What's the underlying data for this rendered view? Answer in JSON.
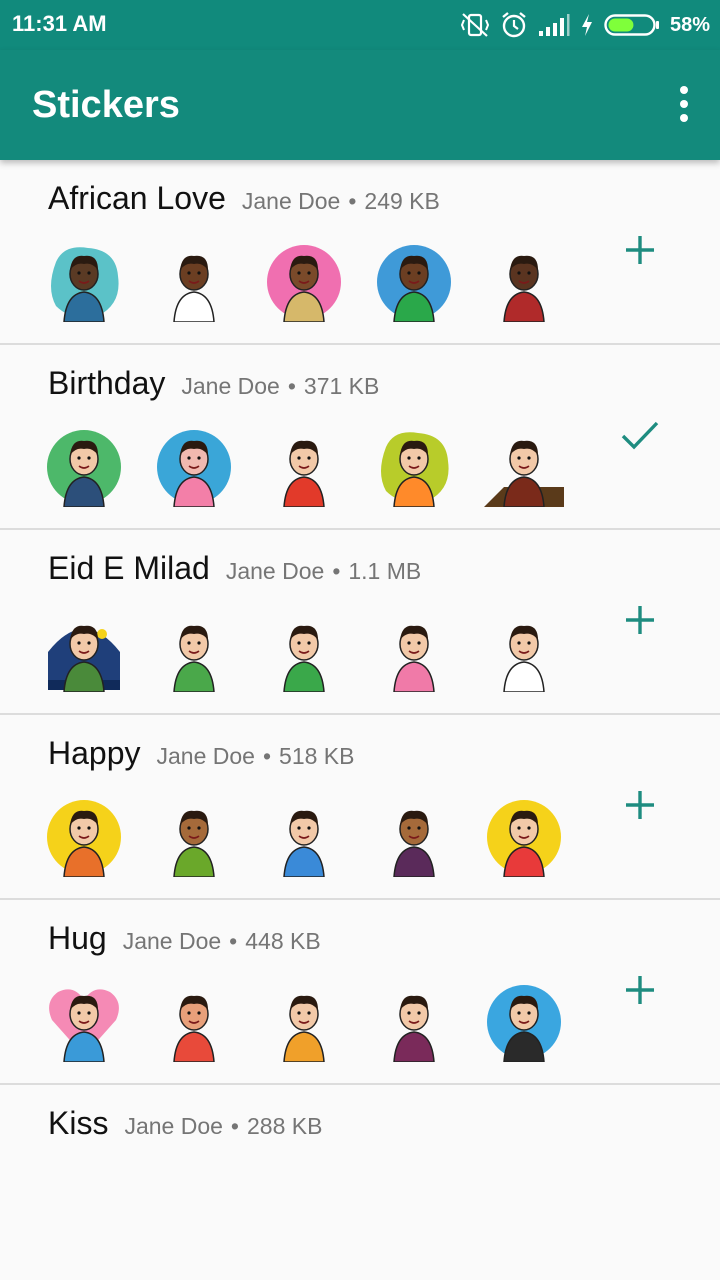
{
  "status_bar": {
    "time": "11:31 AM",
    "battery_percent": "58%",
    "battery_level": 0.58,
    "icons": [
      "vibrate-off-icon",
      "alarm-icon",
      "signal-icon",
      "charging-icon",
      "battery-icon"
    ]
  },
  "app_bar": {
    "title": "Stickers",
    "menu_icon": "overflow-menu-icon"
  },
  "colors": {
    "primary": "#138a7c",
    "accent": "#1e8c80"
  },
  "packs": [
    {
      "name": "African Love",
      "author": "Jane Doe",
      "size": "249 KB",
      "action": "add-icon",
      "stickers": [
        {
          "bg": "#5bc2c8",
          "shape": "blob",
          "skin": "#5a3a24",
          "shirt": "#2c6e9c"
        },
        {
          "bg": "#ffffff",
          "shape": "none",
          "skin": "#6b3e22",
          "shirt": "#ffffff"
        },
        {
          "bg": "#f06fb0",
          "shape": "circle",
          "skin": "#7a4a2a",
          "shirt": "#d6b86a"
        },
        {
          "bg": "#3f9ad8",
          "shape": "circle",
          "skin": "#6b3e22",
          "shirt": "#2aa84a"
        },
        {
          "bg": "#ffffff",
          "shape": "none",
          "skin": "#5a3420",
          "shirt": "#b02a2a"
        }
      ]
    },
    {
      "name": "Birthday",
      "author": "Jane Doe",
      "size": "371 KB",
      "action": "check-icon",
      "stickers": [
        {
          "bg": "#4db86a",
          "shape": "circle",
          "skin": "#f2c9a8",
          "shirt": "#2c4f7a"
        },
        {
          "bg": "#3aa6d8",
          "shape": "circle",
          "skin": "#f1b9b0",
          "shirt": "#f37fa8"
        },
        {
          "bg": "#ffffff",
          "shape": "none",
          "skin": "#f2c9a8",
          "shirt": "#e23a2a"
        },
        {
          "bg": "#b8cc2a",
          "shape": "blob",
          "skin": "#f2c9a8",
          "shirt": "#ff8a2a"
        },
        {
          "bg": "#5a3a1a",
          "shape": "table",
          "skin": "#f2c9a8",
          "shirt": "#7a2a1a"
        }
      ]
    },
    {
      "name": "Eid E Milad",
      "author": "Jane Doe",
      "size": "1.1 MB",
      "action": "add-icon",
      "stickers": [
        {
          "bg": "#1f3f7a",
          "shape": "dome",
          "skin": "#f2c9a8",
          "shirt": "#4a8a3a"
        },
        {
          "bg": "#ffffff",
          "shape": "none",
          "skin": "#f2c9a8",
          "shirt": "#4aa84a"
        },
        {
          "bg": "#ffffff",
          "shape": "none",
          "skin": "#f2c9a8",
          "shirt": "#3aa84a"
        },
        {
          "bg": "#ffffff",
          "shape": "none",
          "skin": "#f2c9a8",
          "shirt": "#f07aa8"
        },
        {
          "bg": "#ffffff",
          "shape": "none",
          "skin": "#f2c9a8",
          "shirt": "#ffffff"
        }
      ]
    },
    {
      "name": "Happy",
      "author": "Jane Doe",
      "size": "518 KB",
      "action": "add-icon",
      "stickers": [
        {
          "bg": "#f5d21a",
          "shape": "circle",
          "skin": "#f2c9a8",
          "shirt": "#e8702a"
        },
        {
          "bg": "#ffffff",
          "shape": "none",
          "skin": "#a56a3a",
          "shirt": "#6aa82a"
        },
        {
          "bg": "#ffffff",
          "shape": "none",
          "skin": "#f2c9a8",
          "shirt": "#3a8ad8"
        },
        {
          "bg": "#ffffff",
          "shape": "none",
          "skin": "#a56a3a",
          "shirt": "#5a2a5a"
        },
        {
          "bg": "#f5d21a",
          "shape": "circle",
          "skin": "#f2c9a8",
          "shirt": "#e83a3a"
        }
      ]
    },
    {
      "name": "Hug",
      "author": "Jane Doe",
      "size": "448 KB",
      "action": "add-icon",
      "stickers": [
        {
          "bg": "#f58ab5",
          "shape": "heart",
          "skin": "#f2c9a8",
          "shirt": "#3a9ad8"
        },
        {
          "bg": "#ffffff",
          "shape": "none",
          "skin": "#e8a07a",
          "shirt": "#e84a3a"
        },
        {
          "bg": "#ffffff",
          "shape": "none",
          "skin": "#f2c9a8",
          "shirt": "#f0a02a"
        },
        {
          "bg": "#ffffff",
          "shape": "none",
          "skin": "#f2c9a8",
          "shirt": "#7a2a5a"
        },
        {
          "bg": "#3aa6e0",
          "shape": "circle",
          "skin": "#f2c9a8",
          "shirt": "#2a2a2a"
        }
      ]
    },
    {
      "name": "Kiss",
      "author": "Jane Doe",
      "size": "288 KB",
      "action": "",
      "stickers": []
    }
  ]
}
